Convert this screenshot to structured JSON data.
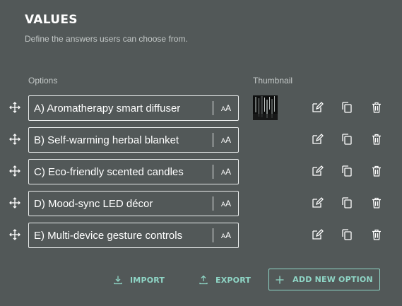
{
  "section": {
    "title": "VALUES",
    "subtitle": "Define the answers users can choose from."
  },
  "columns": {
    "options": "Options",
    "thumbnail": "Thumbnail"
  },
  "options": [
    {
      "label": "A) Aromatherapy smart diffuser",
      "has_thumbnail": true
    },
    {
      "label": "B) Self-warming herbal blanket",
      "has_thumbnail": false
    },
    {
      "label": "C) Eco-friendly scented candles",
      "has_thumbnail": false
    },
    {
      "label": "D) Mood-sync LED décor",
      "has_thumbnail": false
    },
    {
      "label": "E) Multi-device gesture controls",
      "has_thumbnail": false
    }
  ],
  "format_toggle": {
    "big": "A",
    "small": "A"
  },
  "row_icons": {
    "drag": "move-arrows-icon",
    "format": "text-size-icon",
    "edit": "edit-pencil-icon",
    "copy": "duplicate-icon",
    "delete": "trash-icon"
  },
  "footer": {
    "import_label": "IMPORT",
    "export_label": "EXPORT",
    "add_label": "ADD NEW OPTION"
  },
  "colors": {
    "background": "#525858",
    "accent": "#8fd6c6",
    "field_border": "#e9ecec",
    "muted_text": "#c3c8c7"
  }
}
